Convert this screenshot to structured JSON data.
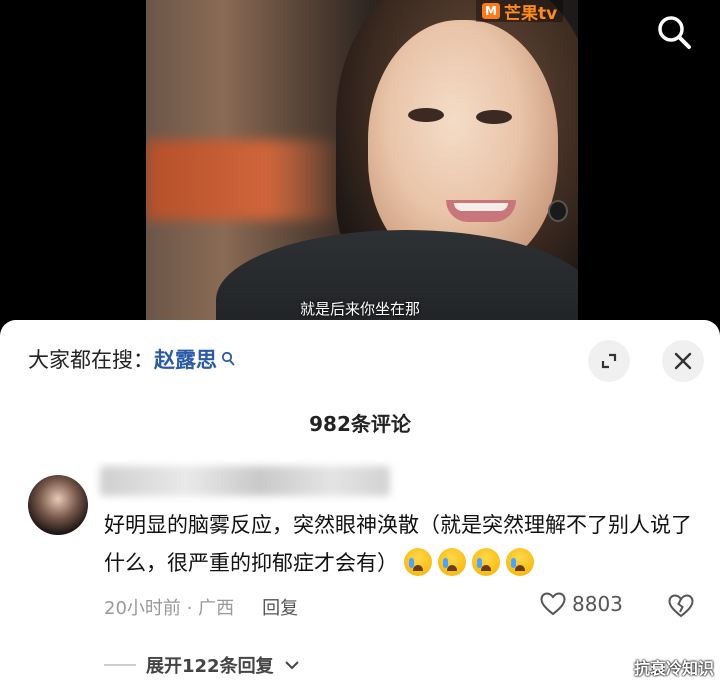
{
  "video": {
    "logo_text": "芒果tv",
    "subtitle": "就是后来你坐在那"
  },
  "sheet": {
    "search_prefix": "大家都在搜：",
    "search_term": "赵露思",
    "comment_count": "982条评论"
  },
  "comment": {
    "text": "好明显的脑雾反应，突然眼神涣散（就是突然理解不了别人说了什么，很严重的抑郁症才会有）",
    "emojis": [
      "crying-face",
      "crying-face",
      "crying-face",
      "crying-face"
    ],
    "time": "20小时前",
    "location": "广西",
    "reply_label": "回复",
    "likes": "8803",
    "expand_label": "展开122条回复"
  },
  "watermark": "抗衰冷知识",
  "colors": {
    "search_term": "#2b5aa5",
    "logo": "#ff8a1f"
  }
}
